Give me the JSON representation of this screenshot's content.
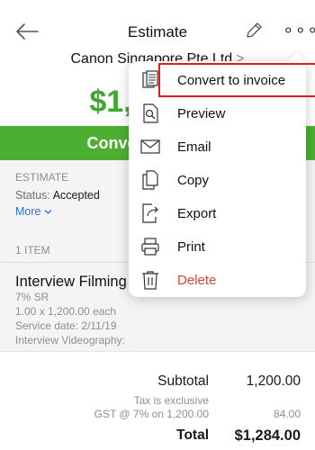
{
  "header": {
    "title": "Estimate",
    "customer": "Canon Singapore Pte Ltd",
    "customer_chevron": ">",
    "amount": "$1,284.00"
  },
  "action_bar": {
    "label": "Convert to invoice"
  },
  "estimate": {
    "label": "ESTIMATE",
    "status_label": "Status:",
    "status_value": "Accepted",
    "more_label": "More"
  },
  "items": {
    "count_label": "1 ITEM",
    "list": [
      {
        "name": "Interview Filming",
        "tax": "7% SR",
        "qty_price": "1.00 x 1,200.00 each",
        "service_date": "Service date: 2/11/19",
        "description": "Interview Videography:"
      }
    ]
  },
  "totals": {
    "subtotal_label": "Subtotal",
    "subtotal_value": "1,200.00",
    "tax_note": "Tax is exclusive",
    "gst_label": "GST @ 7% on 1,200.00",
    "gst_value": "84.00",
    "total_label": "Total",
    "total_value": "$1,284.00"
  },
  "menu": {
    "items": [
      {
        "label": "Convert to invoice",
        "icon": "convert-icon"
      },
      {
        "label": "Preview",
        "icon": "preview-icon"
      },
      {
        "label": "Email",
        "icon": "email-icon"
      },
      {
        "label": "Copy",
        "icon": "copy-icon"
      },
      {
        "label": "Export",
        "icon": "export-icon"
      },
      {
        "label": "Print",
        "icon": "print-icon"
      },
      {
        "label": "Delete",
        "icon": "trash-icon"
      }
    ]
  },
  "colors": {
    "accent_green": "#4caf32",
    "amount_green": "#3ea82e",
    "link_blue": "#2f6fd8",
    "delete_red": "#e0403a",
    "highlight_red": "#e01b1b"
  }
}
